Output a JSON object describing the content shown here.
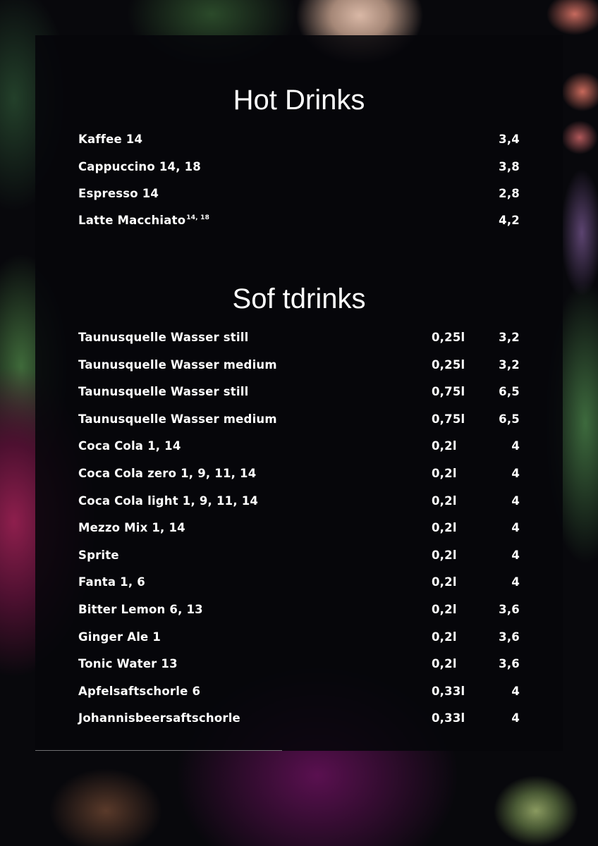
{
  "hot_drinks": {
    "title": "Hot Drinks",
    "items": [
      {
        "name": "Kaffee 14",
        "sup": "",
        "price": "3,4"
      },
      {
        "name": "Cappuccino 14, 18",
        "sup": "",
        "price": "3,8"
      },
      {
        "name": "Espresso 14",
        "sup": "",
        "price": "2,8"
      },
      {
        "name": "Latte Macchiato",
        "sup": "14, 18",
        "price": "4,2"
      }
    ]
  },
  "soft_drinks": {
    "title": "Sof tdrinks",
    "items": [
      {
        "name": "Taunusquelle Wasser still",
        "size": "0,25l",
        "price": "3,2"
      },
      {
        "name": "Taunusquelle Wasser medium",
        "size": "0,25l",
        "price": "3,2"
      },
      {
        "name": "Taunusquelle Wasser still",
        "size": "0,75l",
        "price": "6,5"
      },
      {
        "name": "Taunusquelle Wasser medium",
        "size": "0,75l",
        "price": "6,5"
      },
      {
        "name": "Coca Cola 1, 14",
        "size": "0,2l",
        "price": "4"
      },
      {
        "name": "Coca Cola zero 1, 9, 11, 14",
        "size": "0,2l",
        "price": "4"
      },
      {
        "name": "Coca Cola light 1, 9, 11, 14",
        "size": "0,2l",
        "price": "4"
      },
      {
        "name": "Mezzo Mix 1, 14",
        "size": "0,2l",
        "price": "4"
      },
      {
        "name": "Sprite",
        "size": "0,2l",
        "price": "4"
      },
      {
        "name": "Fanta 1, 6",
        "size": "0,2l",
        "price": "4"
      },
      {
        "name": "Bitter Lemon 6, 13",
        "size": "0,2l",
        "price": "3,6"
      },
      {
        "name": "Ginger Ale 1",
        "size": "0,2l",
        "price": "3,6"
      },
      {
        "name": "Tonic Water 13",
        "size": "0,2l",
        "price": "3,6"
      },
      {
        "name": "Apfelsaftschorle 6",
        "size": "0,33l",
        "price": "4"
      },
      {
        "name": "Johannisbeersaftschorle",
        "size": "0,33l",
        "price": "4"
      }
    ]
  }
}
